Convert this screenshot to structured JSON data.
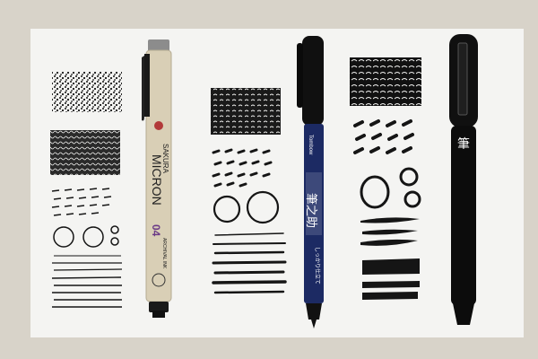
{
  "scene": {
    "description_tag": "pens-and-ink-swatches-photo",
    "colors": {
      "table": "#d8d3c9",
      "paper": "#f4f4f2",
      "ink": "#151515",
      "micron_body": "#d9cfb6",
      "micron_cap_tip": "#8c8c8c",
      "brush_pen_body": "#1c2a63",
      "cap_black": "#101010",
      "label_purple": "#6b3a86"
    },
    "pens": [
      {
        "id": "micron",
        "brand_text": "SAKURA",
        "name_text": "MICRON",
        "size_text": "04",
        "note_text": "ARCHIVAL INK"
      },
      {
        "id": "tombow-fudenosuke",
        "brand_text": "Tombow",
        "name_text": "筆之助",
        "note_text": "しっかり仕立て"
      },
      {
        "id": "pentel-pocket-brush",
        "name_text": "筆"
      }
    ]
  }
}
